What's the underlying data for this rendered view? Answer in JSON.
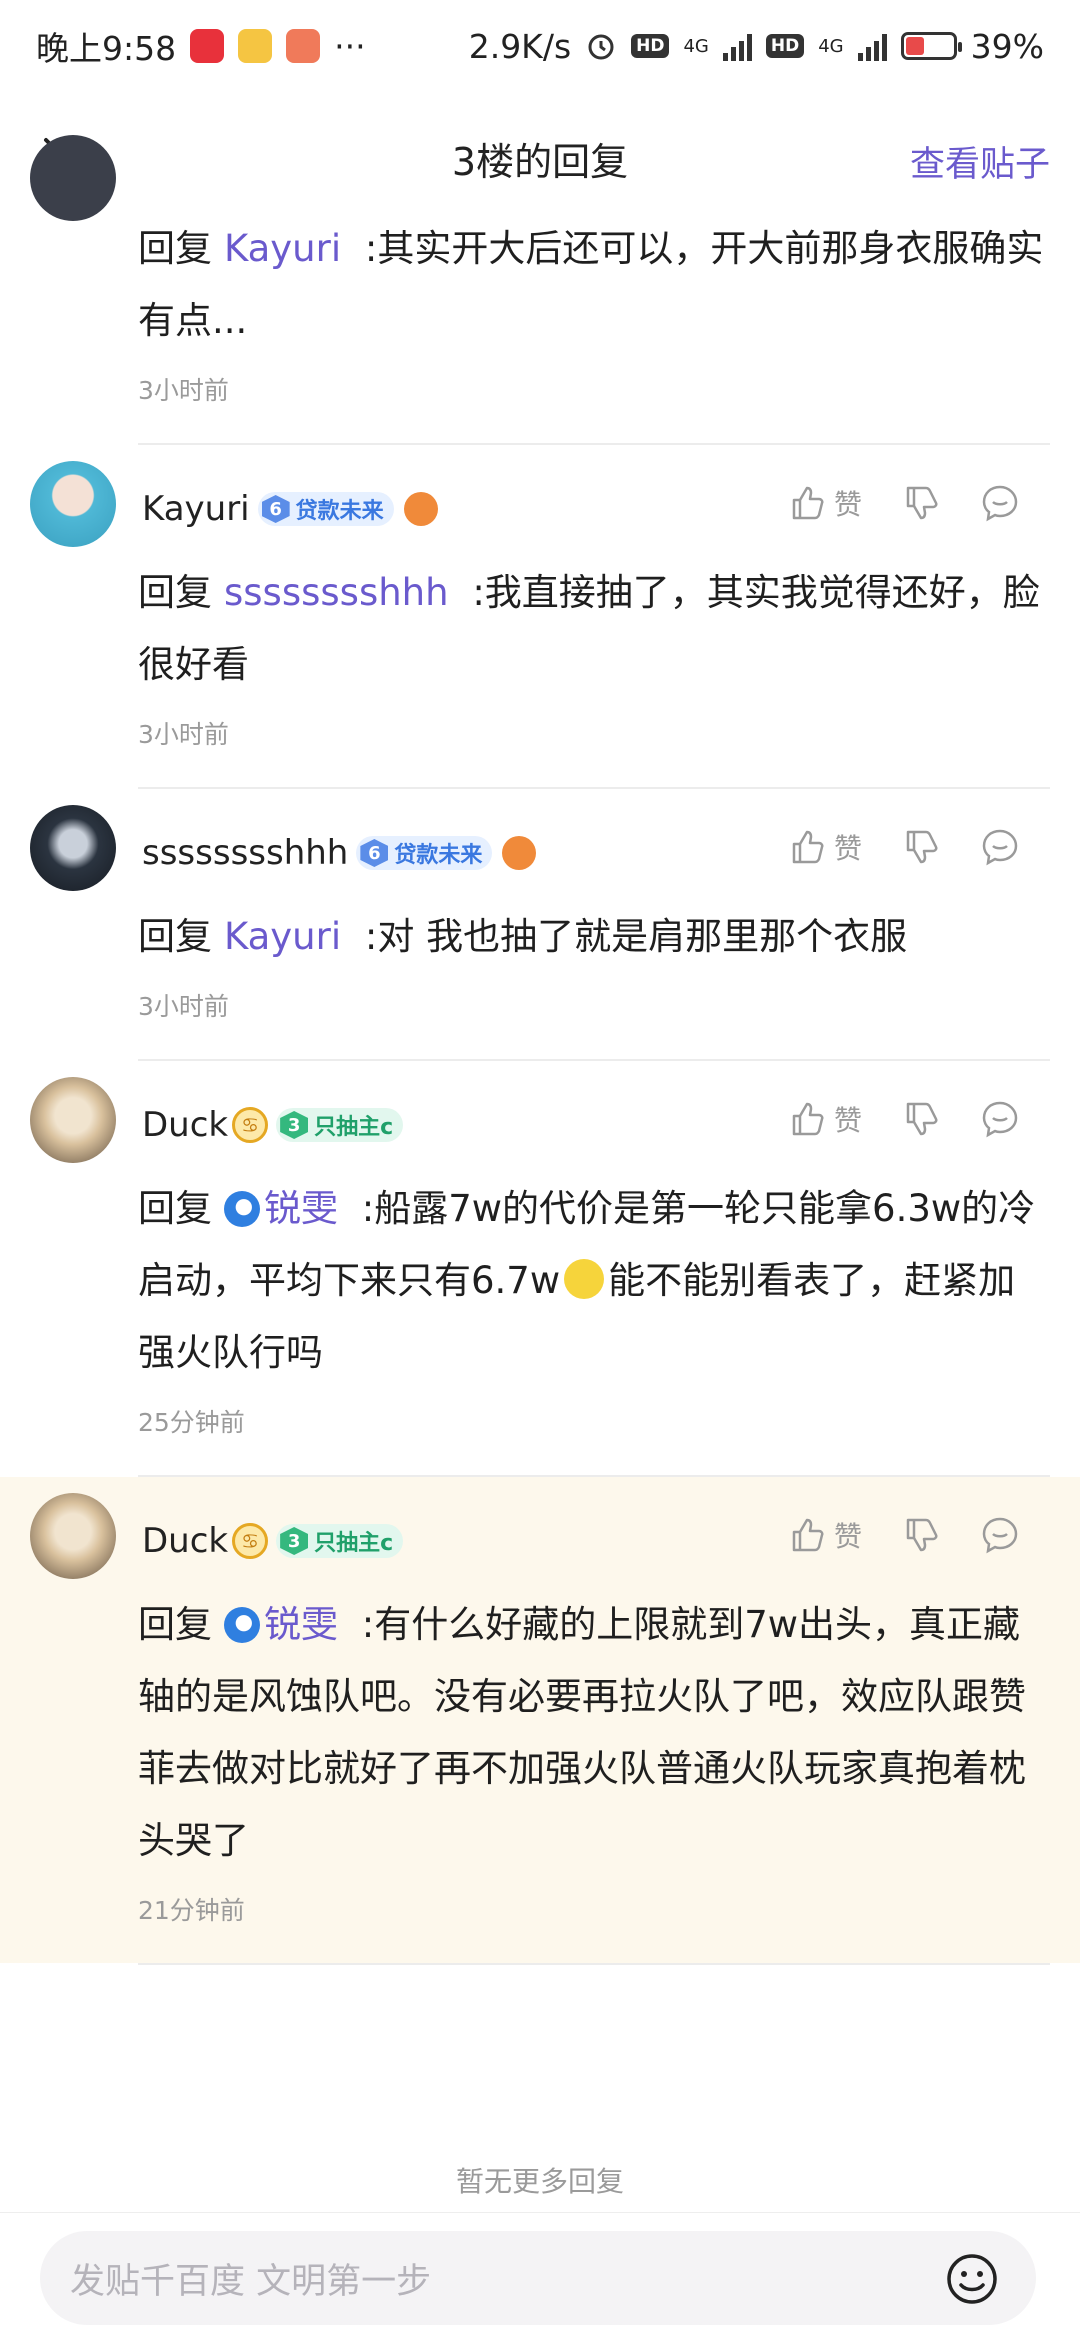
{
  "status_bar": {
    "time": "晚上9:58",
    "more": "···",
    "speed": "2.9K/s",
    "network1": "4G",
    "network2": "4G",
    "battery": "39%",
    "battery_level": 0.39,
    "app_icon_colors": [
      "#e8313b",
      "#f5c542",
      "#f07a5a"
    ]
  },
  "header": {
    "title": "3楼的回复",
    "view_post": "查看贴子"
  },
  "replies": [
    {
      "reply_word": "回复",
      "mention": "Kayuri",
      "text": " :其实开大后还可以，开大前那身衣服确实有点...",
      "time": "3小时前"
    },
    {
      "username": "Kayuri",
      "level": "6",
      "badge": "贷款未来",
      "reply_word": "回复",
      "mention": "sssssssshhh",
      "text": " :我直接抽了，其实我觉得还好，脸很好看",
      "time": "3小时前",
      "like_label": "赞"
    },
    {
      "username": "sssssssshhh",
      "level": "6",
      "badge": "贷款未来",
      "reply_word": "回复",
      "mention": "Kayuri",
      "text": " :对 我也抽了就是肩那里那个衣服",
      "time": "3小时前",
      "like_label": "赞"
    },
    {
      "username": "Duck",
      "level": "3",
      "badge": "只抽主c",
      "reply_word": "回复",
      "mention": "锐雯",
      "text_a": " :船露7w的代价是第一轮只能拿6.3w的冷启动，平均下来只有6.7w",
      "text_b": "能不能别看表了，赶紧加强火队行吗",
      "time": "25分钟前",
      "like_label": "赞"
    },
    {
      "username": "Duck",
      "level": "3",
      "badge": "只抽主c",
      "reply_word": "回复",
      "mention": "锐雯",
      "text": " :有什么好藏的上限就到7w出头，真正藏轴的是风蚀队吧。没有必要再拉火队了吧，效应队跟赞菲去做对比就好了再不加强火队普通火队玩家真抱着枕头哭了",
      "time": "21分钟前",
      "like_label": "赞"
    }
  ],
  "footer": {
    "no_more": "暂无更多回复",
    "compose_placeholder": "发贴千百度 文明第一步"
  }
}
